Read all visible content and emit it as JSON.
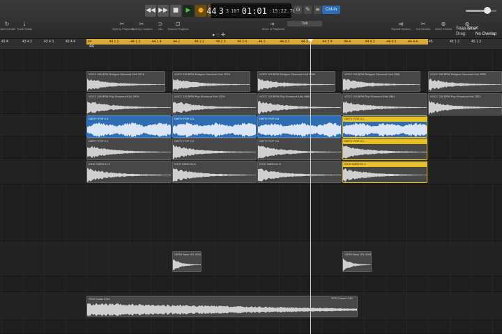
{
  "transport": {
    "rewind": "◀◀",
    "forward": "▶▶",
    "stop": "■",
    "play": "▶",
    "record": "●",
    "cycle": "⟳"
  },
  "lcd": {
    "bar": "44",
    "beat": "3",
    "division": "3",
    "tick": "107",
    "time": "01:01",
    "time_sub": ":15:22.76"
  },
  "count_in": "Cnt-in",
  "master_volume": 0.7,
  "toolbar": {
    "tools": [
      {
        "label": "Catch Handle",
        "icon": "↻"
      },
      {
        "label": "Track Grade",
        "icon": "♩"
      },
      {
        "label": "Split by Playhead",
        "icon": "✂"
      },
      {
        "label": "Split by Locators",
        "icon": "✂"
      },
      {
        "label": "Join",
        "icon": "⊃"
      },
      {
        "label": "Bounce Regions",
        "icon": "⊡"
      },
      {
        "label": "Move to Playhead",
        "icon": "⇥"
      },
      {
        "label": "Nudge Value",
        "icon": ""
      },
      {
        "label": "Repeat Section",
        "icon": "⇉"
      },
      {
        "label": "Cut Section",
        "icon": "✂"
      },
      {
        "label": "Insert Section",
        "icon": "⊕"
      },
      {
        "label": "Insert Silence",
        "icon": "⊕"
      }
    ],
    "nudge_value": "Tick"
  },
  "track_header": {
    "tools": "▸ ◦ ✛",
    "snap_label": "Snap:",
    "snap_value": "Smart",
    "drag_label": "Drag:",
    "drag_value": "No Overlap"
  },
  "ruler": {
    "cycle_start": "44",
    "left_ticks": [
      "43 4",
      "43 4 2",
      "43 4 3",
      "43 4 4"
    ],
    "cycle_ticks": [
      "44",
      "44 1 2",
      "44 1 3",
      "44 1 4",
      "44 2",
      "44 2 2",
      "44 2 3",
      "44 2 4",
      "44 3",
      "44 3 2",
      "44 3 3",
      "44 3 4",
      "44 4",
      "44 4 2",
      "44 4 3",
      "44 4 4"
    ],
    "right_ticks": [
      "45",
      "45 1 2",
      "45 1 3"
    ]
  },
  "regions": {
    "kick_names": [
      "VOC2 126 BPM Religion Shoutout Kick 2976",
      "VOC2 126 BPM Religion Shoutout Kick 2978",
      "VOC2 126 BPM Religion Shoutout Kick 2980",
      "VOC2 126 BPM Religion Shoutout Kick 2981",
      "VOC2 126 BPM Religion Shoutout Kick 2985"
    ],
    "pop_names": [
      "VOC2 126 BPM Pop Shoutout Kick 2976",
      "VOC2 126 BPM Pop Shoutout Kick 2978",
      "VOC2 126 BPM Pop Shoutout Kick 2980",
      "VOC2 126 BPM Pop Shoutout Kick 2981",
      "VOC2 126 BPM Pop Shoutout Kick 2822"
    ],
    "dirty_blue": [
      "DIRTY POP 4.3",
      "DIRTY POP 4.3",
      "DIRTY POP 4.8"
    ],
    "dirty_selected": "DIRTY POP 4.1",
    "dirty_gray": [
      "DIRTY POP 0.3",
      "DIRTY POP 0.3",
      "DIRTY POP 0.6",
      "DIRTY POP 4.1"
    ],
    "kick_hard": [
      "KICK HARD 01.6",
      "KICK HARD 01.6",
      "KICK HARD 01.6",
      "KICK HARD 01.1"
    ],
    "bass_left": "VERH Bass 001 0008",
    "bass_right": "VERH Bass 001 0008",
    "long_left": "STW Crash 1744",
    "long_right": "STW Crash 1744"
  }
}
